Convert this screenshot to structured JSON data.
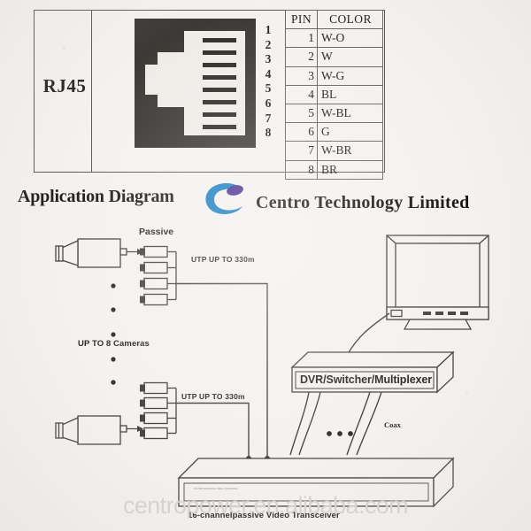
{
  "spec": {
    "connector_label": "RJ45",
    "pin_numbers": [
      "1",
      "2",
      "3",
      "4",
      "5",
      "6",
      "7",
      "8"
    ],
    "table": {
      "headers": [
        "PIN",
        "COLOR"
      ],
      "rows": [
        {
          "pin": "1",
          "color": "W-O"
        },
        {
          "pin": "2",
          "color": "W"
        },
        {
          "pin": "3",
          "color": "W-G"
        },
        {
          "pin": "4",
          "color": "BL"
        },
        {
          "pin": "5",
          "color": "W-BL"
        },
        {
          "pin": "6",
          "color": "G"
        },
        {
          "pin": "7",
          "color": "W-BR"
        },
        {
          "pin": "8",
          "color": "BR"
        }
      ]
    }
  },
  "header": {
    "title": "Application Diagram",
    "brand": "Centro Technology Limited",
    "logo_name": "centro-c-swoosh-logo",
    "logo_blue": "#1a7fc1",
    "logo_purple": "#4b2f8f"
  },
  "diagram": {
    "passive_label": "Passive",
    "utp_label_top": "UTP UP TO 330m",
    "utp_label_bottom": "UTP UP TO 330m",
    "cameras_label": "UP TO 8 Cameras",
    "coax_label": "Coax",
    "dvr_label": "DVR/Switcher/Multiplexer",
    "transceiver_label": "16-channelpassive Video Transceiver",
    "transceiver_face_label": "16-channelpassive Video Transceiver",
    "camera_count_top": 4,
    "camera_count_bottom": 4
  },
  "watermark": {
    "text": "centropower.en.alibaba.com",
    "color": "#d9d4d1"
  }
}
